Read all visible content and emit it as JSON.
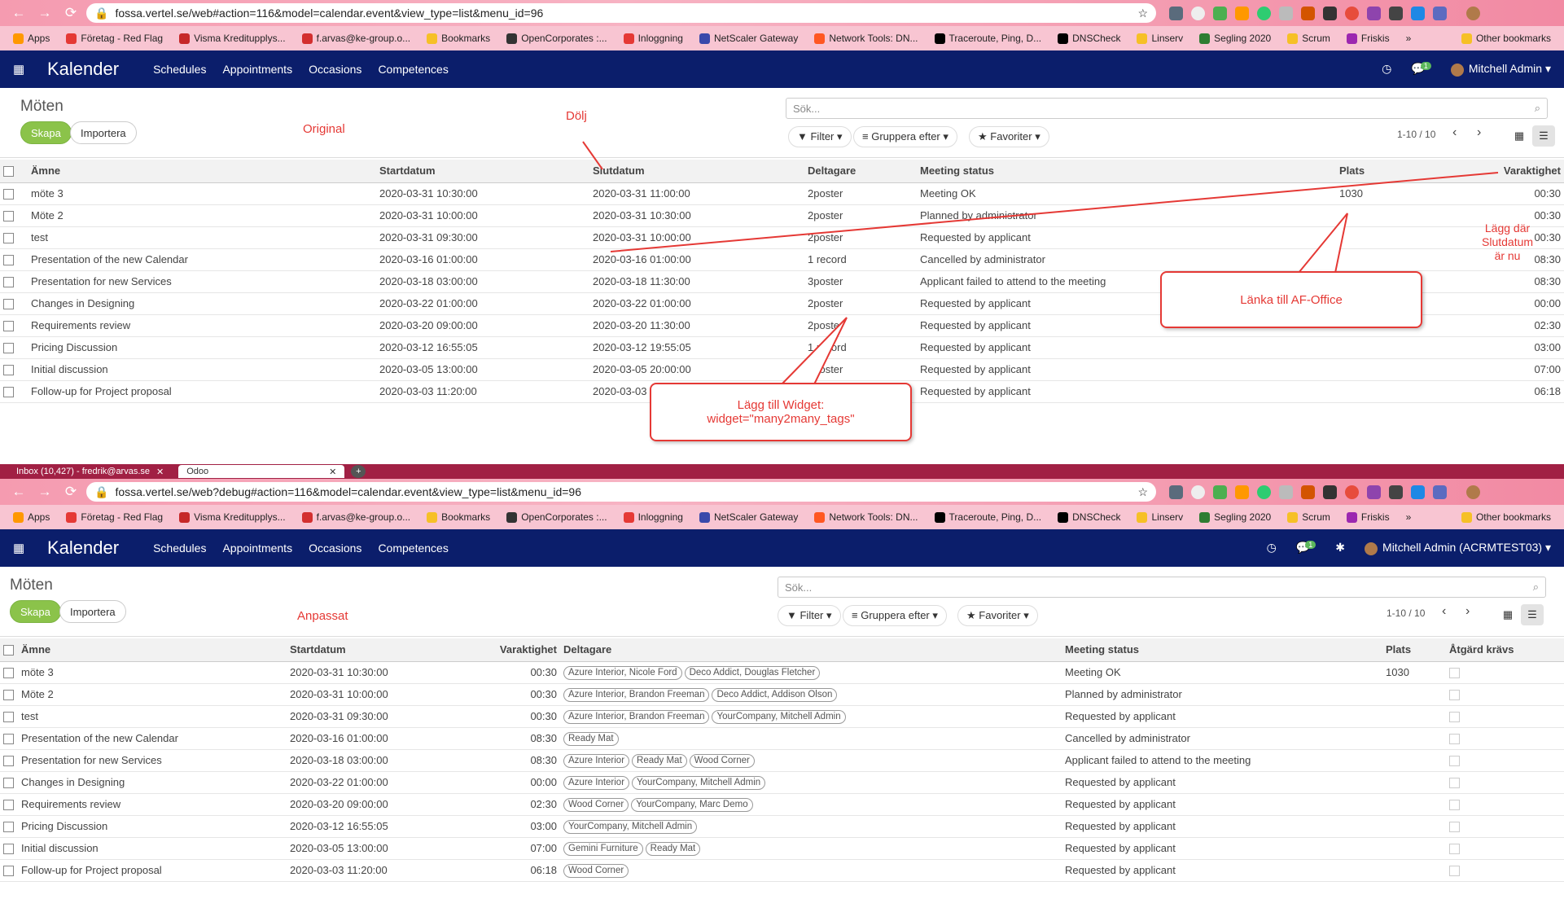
{
  "browser": {
    "url_top": "fossa.vertel.se/web#action=116&model=calendar.event&view_type=list&menu_id=96",
    "url_bottom": "fossa.vertel.se/web?debug#action=116&model=calendar.event&view_type=list&menu_id=96",
    "tabs": [
      {
        "label": "Inbox (10,427) - fredrik@arvas.se"
      },
      {
        "label": "Odoo"
      }
    ],
    "bookmarks": [
      "Apps",
      "Företag - Red Flag",
      "Visma Kreditupplys...",
      "f.arvas@ke-group.o...",
      "Bookmarks",
      "OpenCorporates :...",
      "Inloggning",
      "NetScaler Gateway",
      "Network Tools: DN...",
      "Traceroute, Ping, D...",
      "DNSCheck",
      "Linserv",
      "Segling 2020",
      "Scrum",
      "Friskis"
    ],
    "bookmarks_more": "»",
    "other_bookmarks": "Other bookmarks"
  },
  "app": {
    "brand": "Kalender",
    "menus": [
      "Schedules",
      "Appointments",
      "Occasions",
      "Competences"
    ],
    "user_top": "Mitchell Admin",
    "user_bottom": "Mitchell Admin (ACRMTEST03)",
    "chat_count": "1"
  },
  "control": {
    "title": "Möten",
    "create": "Skapa",
    "import": "Importera",
    "search_placeholder": "Sök...",
    "filter": "Filter",
    "groupby": "Gruppera efter",
    "favorites": "Favoriter",
    "pager": "1-10 / 10"
  },
  "annotations": {
    "original": "Original",
    "anpassat": "Anpassat",
    "dolj": "Dölj",
    "lagg_dar_line1": "Lägg där",
    "lagg_dar_line2": "Slutdatum",
    "lagg_dar_line3": "är nu",
    "lanka": "Länka till AF-Office",
    "widget_line1": "Lägg till Widget:",
    "widget_line2": "widget=\"many2many_tags\""
  },
  "original_table": {
    "headers": [
      "Ämne",
      "Startdatum",
      "Slutdatum",
      "Deltagare",
      "Meeting status",
      "Plats",
      "Varaktighet"
    ],
    "rows": [
      [
        "möte 3",
        "2020-03-31 10:30:00",
        "2020-03-31 11:00:00",
        "2poster",
        "Meeting OK",
        "1030",
        "00:30"
      ],
      [
        "Möte 2",
        "2020-03-31 10:00:00",
        "2020-03-31 10:30:00",
        "2poster",
        "Planned by administrator",
        "",
        "00:30"
      ],
      [
        "test",
        "2020-03-31 09:30:00",
        "2020-03-31 10:00:00",
        "2poster",
        "Requested by applicant",
        "",
        "00:30"
      ],
      [
        "Presentation of the new Calendar",
        "2020-03-16 01:00:00",
        "2020-03-16 01:00:00",
        "1 record",
        "Cancelled by administrator",
        "",
        "08:30"
      ],
      [
        "Presentation for new Services",
        "2020-03-18 03:00:00",
        "2020-03-18 11:30:00",
        "3poster",
        "Applicant failed to attend to the meeting",
        "",
        "08:30"
      ],
      [
        "Changes in Designing",
        "2020-03-22 01:00:00",
        "2020-03-22 01:00:00",
        "2poster",
        "Requested by applicant",
        "",
        "00:00"
      ],
      [
        "Requirements review",
        "2020-03-20 09:00:00",
        "2020-03-20 11:30:00",
        "2poster",
        "Requested by applicant",
        "",
        "02:30"
      ],
      [
        "Pricing Discussion",
        "2020-03-12 16:55:05",
        "2020-03-12 19:55:05",
        "1 record",
        "Requested by applicant",
        "",
        "03:00"
      ],
      [
        "Initial discussion",
        "2020-03-05 13:00:00",
        "2020-03-05 20:00:00",
        "2poster",
        "Requested by applicant",
        "",
        "07:00"
      ],
      [
        "Follow-up for Project proposal",
        "2020-03-03 11:20:00",
        "2020-03-03",
        "",
        "Requested by applicant",
        "",
        "06:18"
      ]
    ]
  },
  "custom_table": {
    "headers": [
      "Ämne",
      "Startdatum",
      "Varaktighet",
      "Deltagare",
      "Meeting status",
      "Plats",
      "Åtgärd krävs"
    ],
    "rows": [
      {
        "subject": "möte 3",
        "start": "2020-03-31 10:30:00",
        "duration": "00:30",
        "tags": [
          "Azure Interior, Nicole Ford",
          "Deco Addict, Douglas Fletcher"
        ],
        "status": "Meeting OK",
        "place": "1030"
      },
      {
        "subject": "Möte 2",
        "start": "2020-03-31 10:00:00",
        "duration": "00:30",
        "tags": [
          "Azure Interior, Brandon Freeman",
          "Deco Addict, Addison Olson"
        ],
        "status": "Planned by administrator",
        "place": ""
      },
      {
        "subject": "test",
        "start": "2020-03-31 09:30:00",
        "duration": "00:30",
        "tags": [
          "Azure Interior, Brandon Freeman",
          "YourCompany, Mitchell Admin"
        ],
        "status": "Requested by applicant",
        "place": ""
      },
      {
        "subject": "Presentation of the new Calendar",
        "start": "2020-03-16 01:00:00",
        "duration": "08:30",
        "tags": [
          "Ready Mat"
        ],
        "status": "Cancelled by administrator",
        "place": ""
      },
      {
        "subject": "Presentation for new Services",
        "start": "2020-03-18 03:00:00",
        "duration": "08:30",
        "tags": [
          "Azure Interior",
          "Ready Mat",
          "Wood Corner"
        ],
        "status": "Applicant failed to attend to the meeting",
        "place": ""
      },
      {
        "subject": "Changes in Designing",
        "start": "2020-03-22 01:00:00",
        "duration": "00:00",
        "tags": [
          "Azure Interior",
          "YourCompany, Mitchell Admin"
        ],
        "status": "Requested by applicant",
        "place": ""
      },
      {
        "subject": "Requirements review",
        "start": "2020-03-20 09:00:00",
        "duration": "02:30",
        "tags": [
          "Wood Corner",
          "YourCompany, Marc Demo"
        ],
        "status": "Requested by applicant",
        "place": ""
      },
      {
        "subject": "Pricing Discussion",
        "start": "2020-03-12 16:55:05",
        "duration": "03:00",
        "tags": [
          "YourCompany, Mitchell Admin"
        ],
        "status": "Requested by applicant",
        "place": ""
      },
      {
        "subject": "Initial discussion",
        "start": "2020-03-05 13:00:00",
        "duration": "07:00",
        "tags": [
          "Gemini Furniture",
          "Ready Mat"
        ],
        "status": "Requested by applicant",
        "place": ""
      },
      {
        "subject": "Follow-up for Project proposal",
        "start": "2020-03-03 11:20:00",
        "duration": "06:18",
        "tags": [
          "Wood Corner"
        ],
        "status": "Requested by applicant",
        "place": ""
      }
    ]
  },
  "icons": {
    "back": "back-arrow-icon",
    "forward": "forward-arrow-icon",
    "reload": "reload-icon",
    "lock": "lock-icon",
    "star": "star-icon",
    "apps": "apps-grid-icon",
    "clock": "clock-icon",
    "chat": "chat-icon",
    "bug": "debug-icon",
    "search": "search-icon",
    "calendar_view": "calendar-view-icon",
    "list_view": "list-view-icon"
  },
  "colors": {
    "navbar": "#0b1e6b",
    "create_button": "#8bc34a",
    "annotation": "#e53935",
    "browser_chrome": "#f59bb0"
  }
}
